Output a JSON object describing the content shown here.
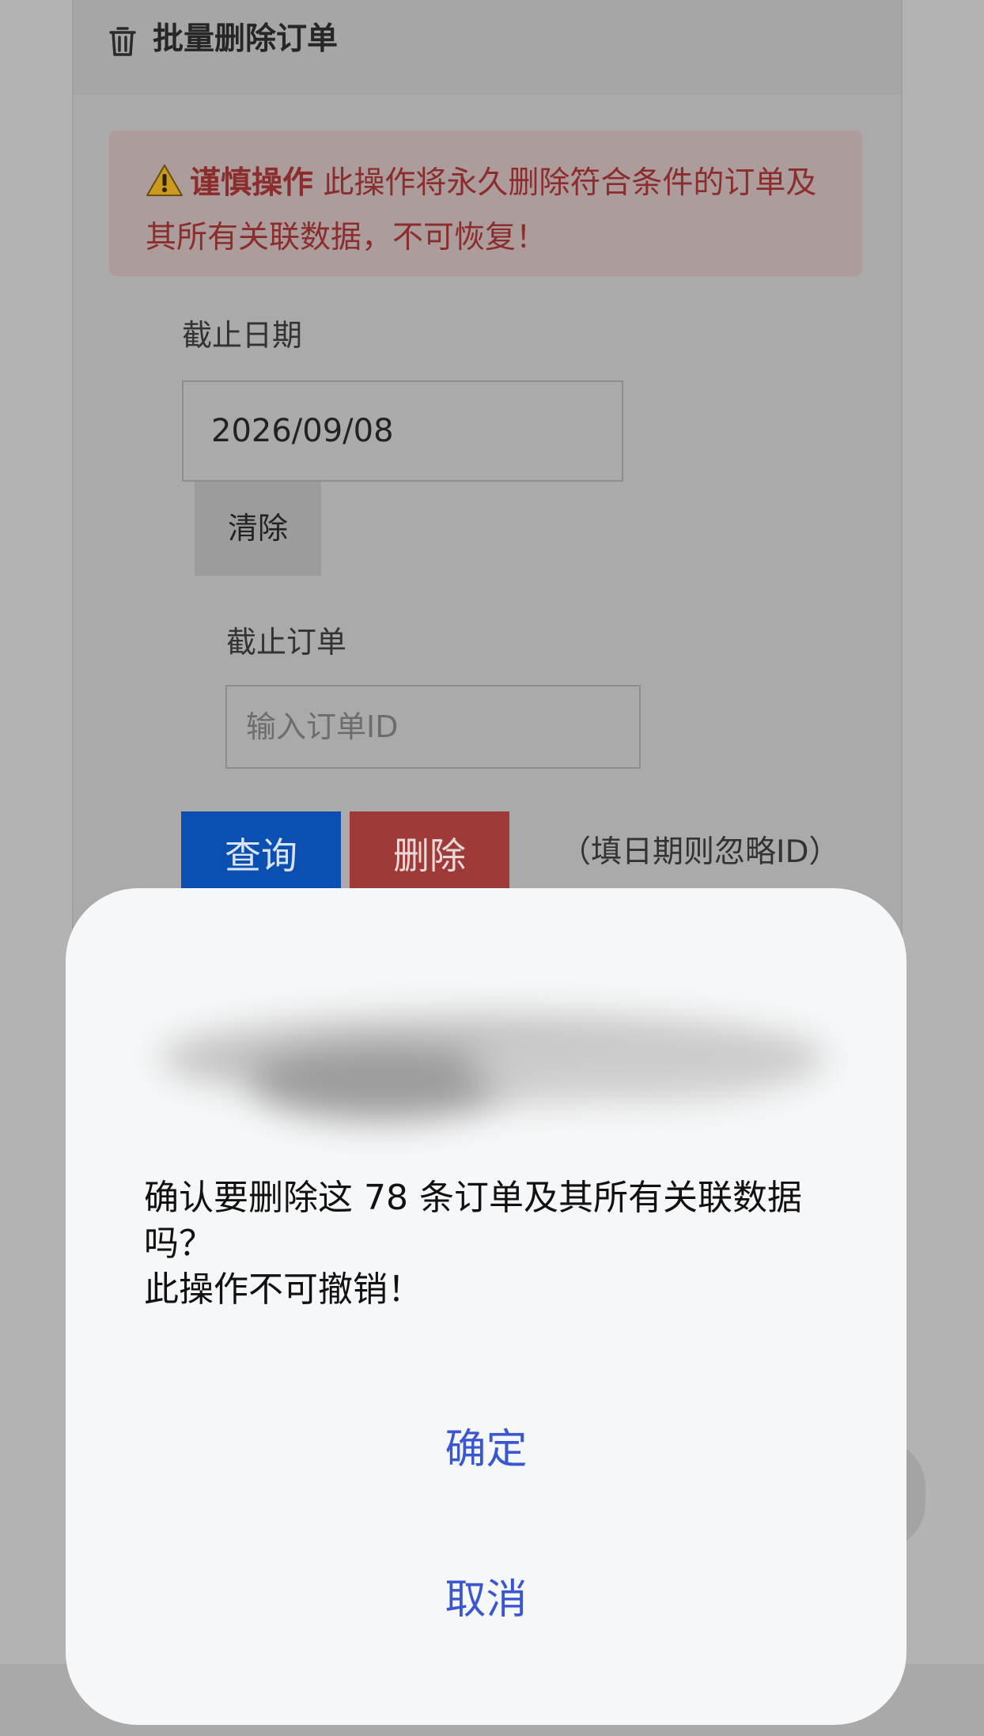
{
  "header": {
    "title": "批量删除订单"
  },
  "alert": {
    "strong": "谨慎操作",
    "text": " 此操作将永久删除符合条件的订单及其所有关联数据，不可恢复！"
  },
  "form": {
    "date_label": "截止日期",
    "date_value": "2026/09/08",
    "clear_label": "清除",
    "order_label": "截止订单",
    "order_placeholder": "输入订单ID",
    "query_label": "查询",
    "delete_label": "删除",
    "hint": "（填日期则忽略ID）"
  },
  "dialog": {
    "message": "确认要删除这 78 条订单及其所有关联数据吗？\n此操作不可撤销！",
    "confirm_label": "确定",
    "cancel_label": "取消"
  },
  "colors": {
    "query": "#0b4fb0",
    "delete": "#9e3b39",
    "dialog_action": "#3a56d0"
  }
}
